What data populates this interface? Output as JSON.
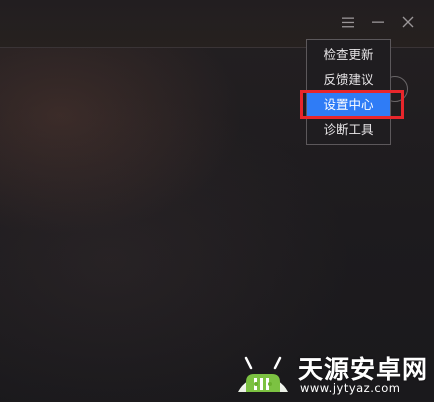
{
  "titlebar": {
    "buttons": [
      {
        "icon": "menu-icon"
      },
      {
        "icon": "minimize-icon"
      },
      {
        "icon": "close-icon"
      }
    ]
  },
  "dropdown_menu": {
    "items": [
      {
        "label": "检查更新",
        "selected": false
      },
      {
        "label": "反馈建议",
        "selected": false
      },
      {
        "label": "设置中心",
        "selected": true
      },
      {
        "label": "诊断工具",
        "selected": false
      }
    ]
  },
  "annotation": {
    "highlight_color": "#e8262b"
  },
  "colors": {
    "selected_item": "#2f7cf6",
    "menu_background": "#1f1d20",
    "window_background": "#1c1a1c"
  },
  "watermark": {
    "title": "天源安卓网",
    "url": "www.jytyaz.com"
  }
}
